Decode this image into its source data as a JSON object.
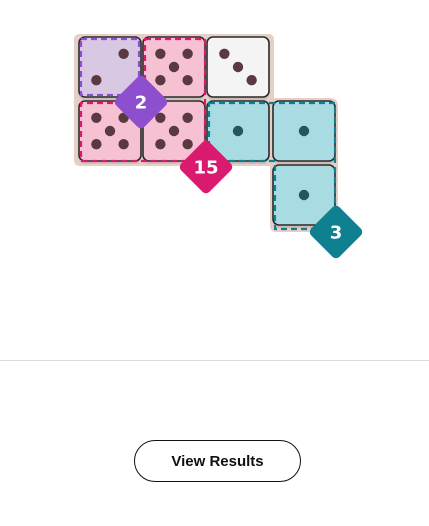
{
  "puzzle": {
    "dice": [
      {
        "id": "die-r1c1",
        "pips": 2,
        "color": "#d8c8e4"
      },
      {
        "id": "die-r1c2",
        "pips": 5,
        "color": "#f5c1d3"
      },
      {
        "id": "die-r1c3",
        "pips": 3,
        "color": "#f4f4f4"
      },
      {
        "id": "die-r2c1",
        "pips": 5,
        "color": "#f5c1d3"
      },
      {
        "id": "die-r2c2",
        "pips": 5,
        "color": "#f5c1d3"
      },
      {
        "id": "die-r2c3",
        "pips": 1,
        "color": "#a9dbe3"
      },
      {
        "id": "die-r2c4",
        "pips": 1,
        "color": "#a9dbe3"
      },
      {
        "id": "die-r3c4",
        "pips": 1,
        "color": "#a9dbe3"
      }
    ],
    "regions": [
      {
        "id": "region-purple",
        "color": "#8e4fcf",
        "target": "2"
      },
      {
        "id": "region-pink",
        "color": "#d91a6e",
        "target": "15"
      },
      {
        "id": "region-teal",
        "color": "#0f8090",
        "target": "3"
      }
    ]
  },
  "actions": {
    "view_results_label": "View Results"
  }
}
